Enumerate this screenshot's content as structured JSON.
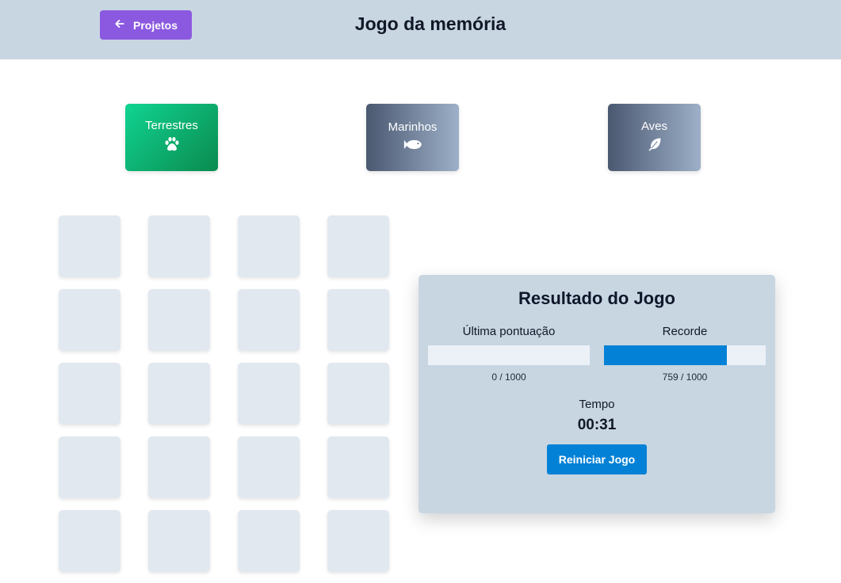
{
  "header": {
    "back_label": "Projetos",
    "back_icon": "arrow-left-icon",
    "title": "Jogo da memória",
    "back_color": "#8b58e0",
    "background": "#c8d6e2"
  },
  "categories": [
    {
      "label": "Terrestres",
      "icon": "paw-icon",
      "selected": true
    },
    {
      "label": "Marinhos",
      "icon": "fish-icon",
      "selected": false
    },
    {
      "label": "Aves",
      "icon": "feather-icon",
      "selected": false
    }
  ],
  "board": {
    "rows": 5,
    "columns": 4,
    "card_color": "#e1e8f0"
  },
  "result": {
    "title": "Resultado do Jogo",
    "last_score": {
      "label": "Última pontuação",
      "value": 0,
      "max": 1000,
      "text": "0 / 1000"
    },
    "record": {
      "label": "Recorde",
      "value": 759,
      "max": 1000,
      "text": "759 / 1000"
    },
    "time_label": "Tempo",
    "time_value": "00:31",
    "restart_label": "Reiniciar Jogo",
    "accent": "#0381d6"
  }
}
